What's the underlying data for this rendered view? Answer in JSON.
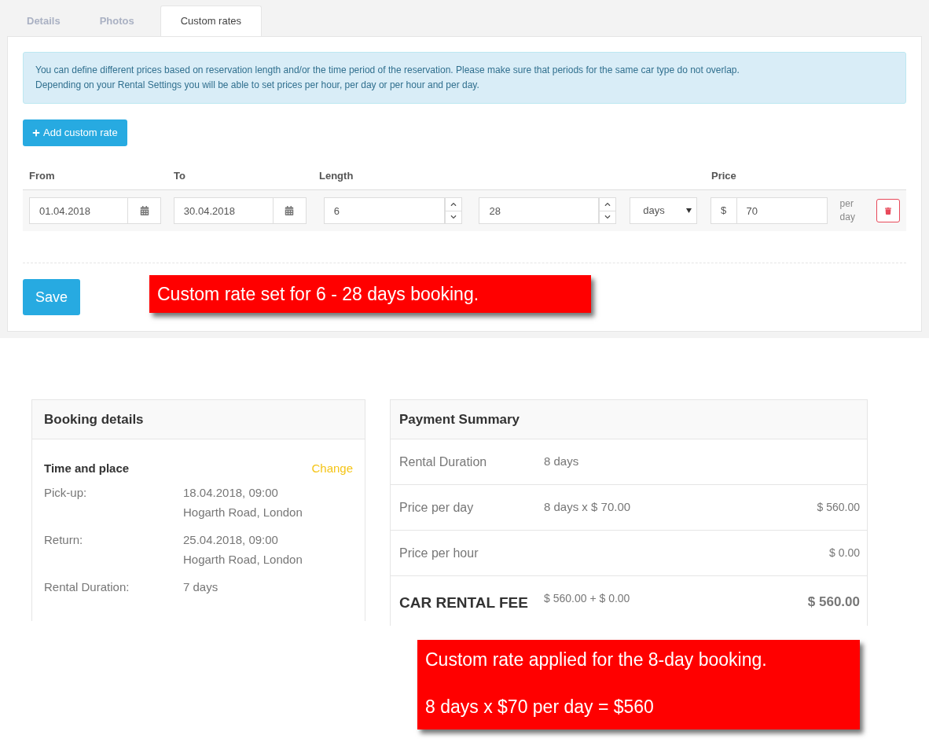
{
  "tabs": [
    {
      "label": "Details",
      "selected": false
    },
    {
      "label": "Photos",
      "selected": false
    },
    {
      "label": "Custom rates",
      "selected": true
    }
  ],
  "info_alert": {
    "lines": [
      "You can define different prices based on reservation length and/or the time period of the reservation. Please make sure that periods for the same car type do not overlap.",
      "Depending on your Rental Settings you will be able to set prices per hour, per day or per hour and per day."
    ]
  },
  "add_button": {
    "label": "Add custom rate"
  },
  "rates_table": {
    "columns": [
      "From",
      "To",
      "Length",
      "Price"
    ],
    "rows": [
      {
        "from": "01.04.2018",
        "to": "30.04.2018",
        "length_min": "6",
        "length_max": "28",
        "unit": "days",
        "currency": "$",
        "price": "70",
        "price_unit": "per day"
      }
    ]
  },
  "save_button": {
    "label": "Save"
  },
  "booking_details": {
    "title": "Booking details",
    "section_title": "Time and place",
    "change_link": "Change",
    "rows": [
      {
        "label": "Pick-up:",
        "values": [
          "18.04.2018, 09:00",
          "Hogarth Road, London"
        ]
      },
      {
        "label": "Return:",
        "values": [
          "25.04.2018, 09:00",
          "Hogarth Road, London"
        ]
      },
      {
        "label": "Rental Duration:",
        "values": [
          "7 days"
        ]
      }
    ]
  },
  "payment_summary": {
    "title": "Payment Summary",
    "rows": [
      {
        "kind": "line",
        "label": "Rental Duration",
        "detail": "8 days"
      },
      {
        "kind": "line",
        "label": "Price per day",
        "detail": "8 days x $ 70.00",
        "amount": "$ 560.00"
      },
      {
        "kind": "line",
        "label": "Price per hour",
        "amount": "$ 0.00"
      },
      {
        "kind": "total",
        "label": "CAR RENTAL FEE",
        "detail": "$ 560.00 + $ 0.00",
        "amount": "$ 560.00"
      }
    ]
  },
  "callouts": [
    {
      "lines": [
        "Custom rate set for 6 - 28 days booking."
      ]
    },
    {
      "lines": [
        "Custom rate applied for the 8-day booking.",
        "8 days x $70 per day = $560"
      ]
    }
  ]
}
